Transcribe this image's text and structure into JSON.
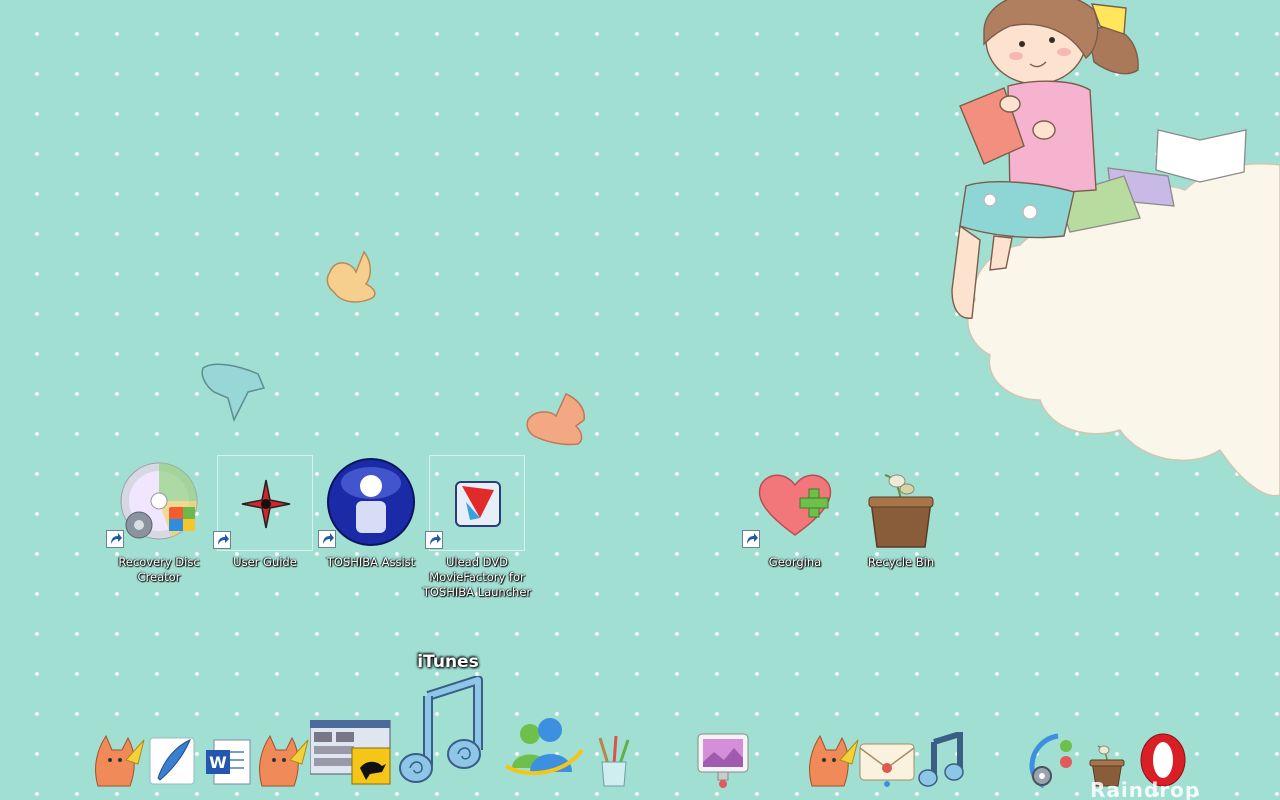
{
  "desktop": {
    "background_color": "#a0dfd2",
    "icons": [
      {
        "label": "Recovery Disc Creator",
        "icon": "recovery-disc-icon",
        "shortcut": true
      },
      {
        "label": "User Guide",
        "icon": "user-guide-icon",
        "shortcut": true,
        "selected": true
      },
      {
        "label": "TOSHIBA Assist",
        "icon": "toshiba-assist-icon",
        "shortcut": true
      },
      {
        "label": "Ulead DVD MovieFactory for TOSHIBA Launcher",
        "icon": "ulead-dvd-icon",
        "shortcut": true,
        "selected": true
      },
      {
        "label": "Georgina",
        "icon": "heart-plus-icon",
        "shortcut": true
      },
      {
        "label": "Recycle Bin",
        "icon": "plant-pot-recycle-icon",
        "shortcut": false
      }
    ]
  },
  "dock": {
    "tooltip": "iTunes",
    "items": [
      {
        "icon": "fox-icon"
      },
      {
        "icon": "quill-icon"
      },
      {
        "icon": "word-document-icon"
      },
      {
        "icon": "fox-icon"
      },
      {
        "icon": "window-thumbnail-icon"
      },
      {
        "icon": "itunes-music-note-icon",
        "hovered": true
      },
      {
        "icon": "messenger-buddies-icon"
      },
      {
        "icon": "paint-brushes-icon"
      },
      {
        "icon": "monitor-icon"
      },
      {
        "icon": "fox-icon"
      },
      {
        "icon": "envelope-icon"
      },
      {
        "icon": "music-note-icon"
      },
      {
        "icon": "gear-settings-icon"
      },
      {
        "icon": "plant-pot-icon"
      },
      {
        "icon": "opera-icon"
      }
    ]
  },
  "watermark": "Raindrop"
}
